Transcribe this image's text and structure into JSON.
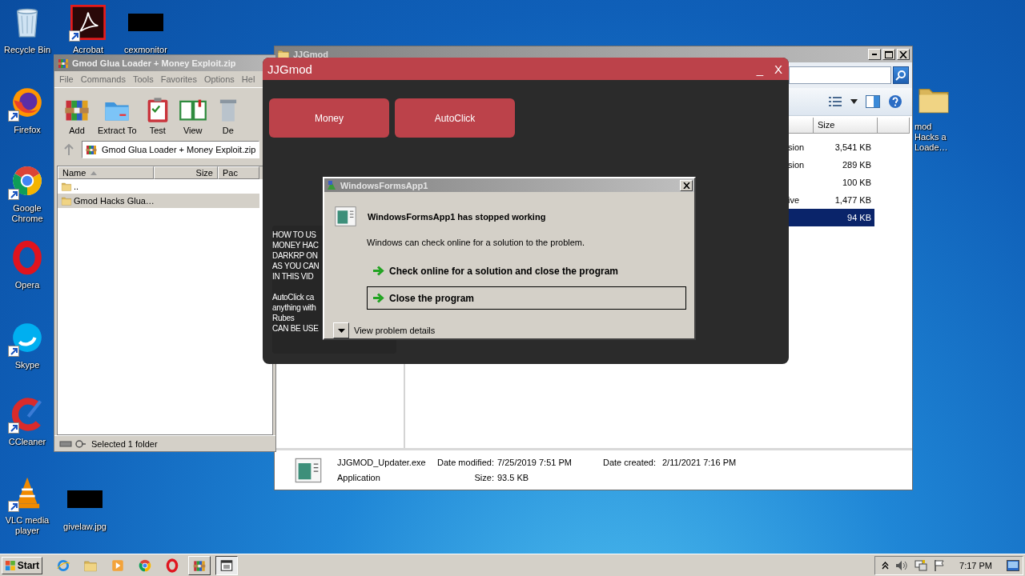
{
  "desktop_icons": [
    {
      "label": "Recycle Bin",
      "kind": "recycle",
      "shortcut": false
    },
    {
      "label": "Acrobat",
      "kind": "acrobat",
      "shortcut": true
    },
    {
      "label": "cexmonitor",
      "kind": "blank",
      "shortcut": false
    },
    {
      "label": "Firefox",
      "kind": "firefox",
      "shortcut": true
    },
    {
      "label": "Google Chrome",
      "kind": "chrome",
      "shortcut": true
    },
    {
      "label": "Opera",
      "kind": "opera",
      "shortcut": false
    },
    {
      "label": "Skype",
      "kind": "skype",
      "shortcut": true
    },
    {
      "label": "CCleaner",
      "kind": "ccleaner",
      "shortcut": true
    },
    {
      "label": "VLC media player",
      "kind": "vlc",
      "shortcut": true
    },
    {
      "label": "givelaw.jpg",
      "kind": "blank",
      "shortcut": false
    },
    {
      "label": "mod Hacks a Loade…",
      "kind": "folder",
      "shortcut": false
    }
  ],
  "explorer_window": {
    "title": "JJGmod",
    "columns": [
      "Size"
    ],
    "rows": [
      {
        "type": "sion",
        "size": "3,541 KB",
        "selected": false
      },
      {
        "type": "sion",
        "size": "289 KB",
        "selected": false
      },
      {
        "size": "100 KB",
        "selected": false
      },
      {
        "type": "ive",
        "size": "1,477 KB",
        "selected": false
      },
      {
        "size": "94 KB",
        "selected": true
      }
    ],
    "details": {
      "name": "JJGMOD_Updater.exe",
      "type": "Application",
      "modified_label": "Date modified:",
      "modified": "7/25/2019 7:51 PM",
      "created_label": "Date created:",
      "created": "2/11/2021 7:16 PM",
      "size_label": "Size:",
      "size": "93.5 KB"
    }
  },
  "winrar_window": {
    "title": "Gmod Glua Loader + Money Exploit.zip",
    "menu": [
      "File",
      "Commands",
      "Tools",
      "Favorites",
      "Options",
      "Hel"
    ],
    "toolbar": [
      {
        "label": "Add",
        "kind": "add"
      },
      {
        "label": "Extract To",
        "kind": "extract"
      },
      {
        "label": "Test",
        "kind": "test"
      },
      {
        "label": "View",
        "kind": "view"
      },
      {
        "label": "De",
        "kind": "delete"
      }
    ],
    "path": "Gmod Glua Loader + Money Exploit.zip",
    "columns": [
      "Name",
      "Size",
      "Pac"
    ],
    "rows": [
      {
        "name": "..",
        "selected": false
      },
      {
        "name": "Gmod Hacks Glua…",
        "selected": true
      }
    ],
    "status": "Selected 1 folder"
  },
  "app_window": {
    "title": "JJGmod",
    "minimize": "_",
    "close": "X",
    "buttons": [
      "Money",
      "AutoClick"
    ],
    "instructions": [
      [
        "HOW TO US",
        "MONEY HAC",
        "DARKRP ON",
        "AS YOU CAN",
        "IN THIS VID"
      ],
      [
        "AutoClick ca",
        "anything with",
        "Rubes",
        "CAN BE USE"
      ]
    ]
  },
  "error_dialog": {
    "title": "WindowsFormsApp1",
    "heading": "WindowsFormsApp1 has stopped working",
    "message": "Windows can check online for a solution to the problem.",
    "options": [
      {
        "label": "Check online for a solution and close the program",
        "selected": false
      },
      {
        "label": "Close the program",
        "selected": true
      }
    ],
    "details": "View problem details"
  },
  "taskbar": {
    "start": "Start",
    "apps": [
      {
        "kind": "ie",
        "running": false,
        "active": false
      },
      {
        "kind": "explorer",
        "running": false,
        "active": false
      },
      {
        "kind": "media",
        "running": false,
        "active": false
      },
      {
        "kind": "chrome",
        "running": false,
        "active": false
      },
      {
        "kind": "opera",
        "running": false,
        "active": false
      },
      {
        "kind": "winrar",
        "running": true,
        "active": false
      },
      {
        "kind": "app",
        "running": true,
        "active": true
      }
    ],
    "clock": "7:17 PM"
  }
}
